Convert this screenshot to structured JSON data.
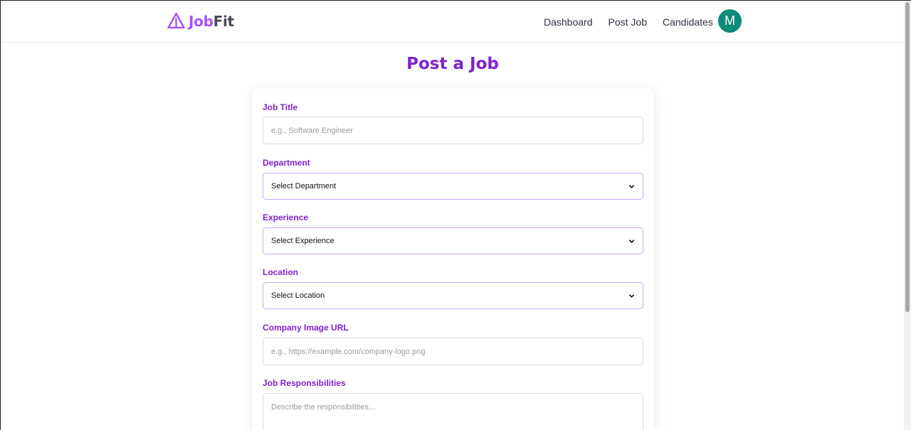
{
  "brand": {
    "part1": "Job",
    "part2": "Fit"
  },
  "nav": {
    "links": [
      "Dashboard",
      "Post Job",
      "Candidates"
    ],
    "avatar_initial": "M"
  },
  "page": {
    "title": "Post a Job"
  },
  "form": {
    "job_title": {
      "label": "Job Title",
      "placeholder": "e.g., Software Engineer"
    },
    "department": {
      "label": "Department",
      "selected": "Select Department"
    },
    "experience": {
      "label": "Experience",
      "selected": "Select Experience"
    },
    "location": {
      "label": "Location",
      "selected": "Select Location"
    },
    "company_image": {
      "label": "Company Image URL",
      "placeholder": "e.g., https://example.com/company-logo.png"
    },
    "responsibilities": {
      "label": "Job Responsibilities",
      "placeholder": "Describe the responsibilities..."
    }
  },
  "colors": {
    "accent": "#7e22ce",
    "brand": "#a855f7",
    "avatar": "#0d8a7a"
  }
}
